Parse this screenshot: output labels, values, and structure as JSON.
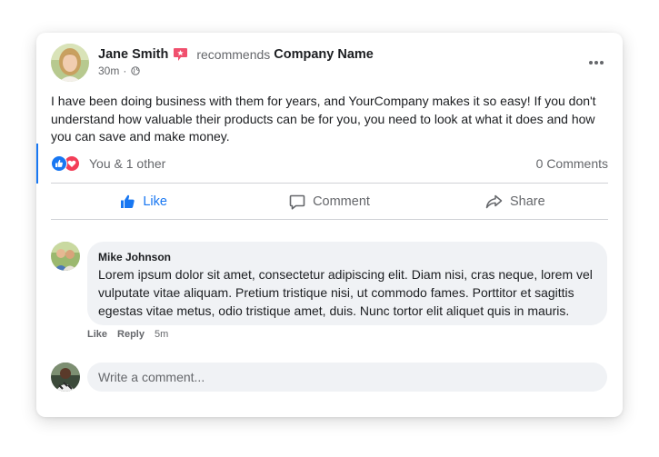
{
  "post": {
    "author": "Jane Smith",
    "author_badge_icon": "recommend-badge-icon",
    "action_text": "recommends",
    "company": "Company Name",
    "time": "30m",
    "separator": "·",
    "privacy_icon": "globe-icon",
    "body": "I have been doing business with them for years, and YourCompany makes it so easy! If you don't understand how valuable their products can be for you, you need to look at what it does and how you can save and make money."
  },
  "reactions": {
    "icons": [
      "like-reaction-icon",
      "love-reaction-icon"
    ],
    "summary": "You & 1 other",
    "comments_count": "0 Comments"
  },
  "actions": {
    "like": "Like",
    "comment": "Comment",
    "share": "Share"
  },
  "comment": {
    "author": "Mike Johnson",
    "text": "Lorem ipsum dolor sit amet, consectetur adipiscing elit. Diam nisi, cras neque, lorem vel vulputate vitae aliquam. Pretium tristique nisi, ut commodo fames. Porttitor et sagittis egestas vitae metus, odio tristique amet, duis. Nunc tortor elit aliquet quis in mauris.",
    "like": "Like",
    "reply": "Reply",
    "time": "5m"
  },
  "composer": {
    "placeholder": "Write a comment..."
  },
  "colors": {
    "accent": "#1877f2",
    "love": "#f33e58",
    "badge": "#f0506e",
    "bubble": "#f0f2f5",
    "secondary_text": "#65676b"
  }
}
